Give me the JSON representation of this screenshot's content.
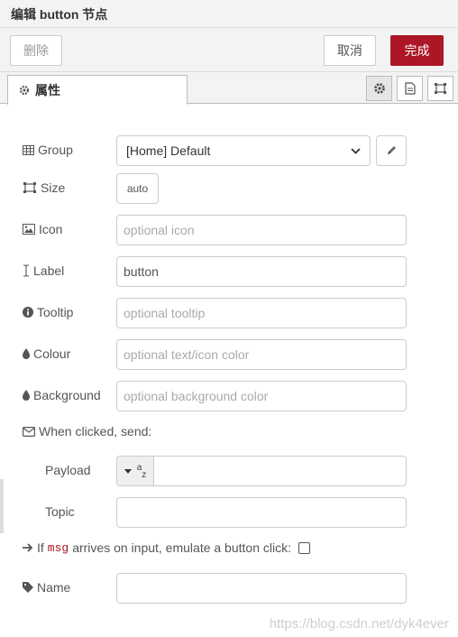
{
  "header": {
    "title": "编辑 button 节点"
  },
  "toolbar": {
    "delete_label": "删除",
    "cancel_label": "取消",
    "done_label": "完成"
  },
  "tabs": {
    "properties_label": "属性"
  },
  "form": {
    "group_label": "Group",
    "group_value": "[Home] Default",
    "size_label": "Size",
    "size_value": "auto",
    "icon_label": "Icon",
    "icon_placeholder": "optional icon",
    "label_label": "Label",
    "label_value": "button",
    "tooltip_label": "Tooltip",
    "tooltip_placeholder": "optional tooltip",
    "colour_label": "Colour",
    "colour_placeholder": "optional text/icon color",
    "background_label": "Background",
    "background_placeholder": "optional background color",
    "when_clicked_label": "When clicked, send:",
    "payload_label": "Payload",
    "payload_type": "az",
    "payload_value": "",
    "topic_label": "Topic",
    "topic_value": "",
    "emulate_prefix": "If",
    "emulate_code": "msg",
    "emulate_suffix": "arrives on input, emulate a button click:",
    "emulate_checked": false,
    "name_label": "Name",
    "name_value": ""
  },
  "watermark": "https://blog.csdn.net/dyk4ever",
  "colors": {
    "primary": "#ad1625",
    "toolbar_bg": "#f3f3f3",
    "border": "#cccccc"
  },
  "icons": [
    "gear-icon",
    "file-icon",
    "frame-icon",
    "table-icon",
    "expand-icon",
    "image-icon",
    "text-cursor-icon",
    "info-icon",
    "droplet-icon",
    "envelope-icon",
    "arrow-right-icon",
    "tag-icon",
    "pencil-icon",
    "caret-down-icon"
  ]
}
